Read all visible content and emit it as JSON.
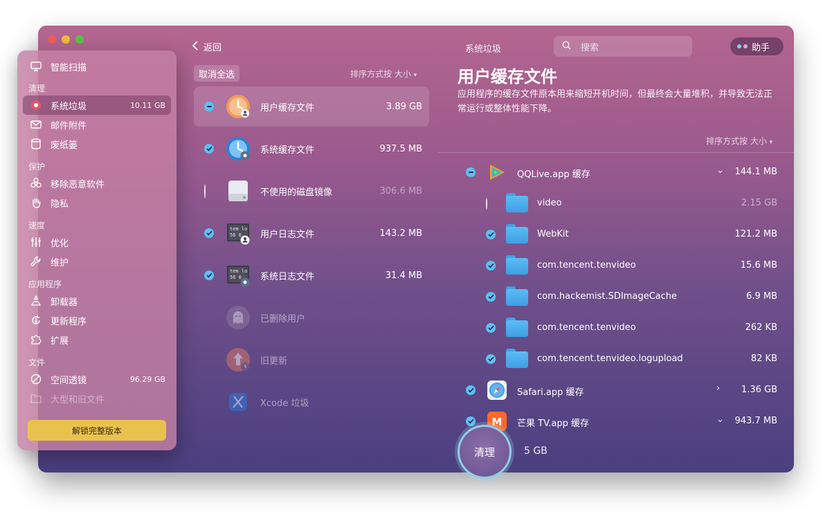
{
  "window": {
    "title": "系统垃圾"
  },
  "sidebar": {
    "smart_scan": "智能扫描",
    "sections": {
      "cleanup": "清理",
      "protect": "保护",
      "speed": "速度",
      "apps": "应用程序",
      "files": "文件"
    },
    "items": {
      "system_junk": {
        "label": "系统垃圾",
        "size": "10.11 GB"
      },
      "mail_attachments": "邮件附件",
      "trash": "废纸篓",
      "malware_removal": "移除恶意软件",
      "privacy": "隐私",
      "optimization": "优化",
      "maintenance": "维护",
      "uninstaller": "卸载器",
      "updater": "更新程序",
      "extensions": "扩展",
      "space_lens": {
        "label": "空间透镜",
        "size": "96.29 GB"
      },
      "large_old_files": "大型和旧文件"
    },
    "unlock_button": "解锁完整版本"
  },
  "middle": {
    "back": "返回",
    "deselect_all": "取消全选",
    "sort": "排序方式按 大小",
    "categories": [
      {
        "label": "用户缓存文件",
        "size": "3.89 GB",
        "state": "partial",
        "icon": "user-cache-clock-icon"
      },
      {
        "label": "系统缓存文件",
        "size": "937.5 MB",
        "state": "checked",
        "icon": "system-cache-clock-icon"
      },
      {
        "label": "不使用的磁盘镜像",
        "size": "306.6 MB",
        "state": "unchecked",
        "icon": "disk-image-icon"
      },
      {
        "label": "用户日志文件",
        "size": "143.2 MB",
        "state": "checked",
        "icon": "user-log-icon"
      },
      {
        "label": "系统日志文件",
        "size": "31.4 MB",
        "state": "checked",
        "icon": "system-log-icon"
      },
      {
        "label": "已删除用户",
        "size": "",
        "state": "none",
        "icon": "ghost-user-icon"
      },
      {
        "label": "旧更新",
        "size": "",
        "state": "none",
        "icon": "old-update-icon"
      },
      {
        "label": "Xcode 垃圾",
        "size": "",
        "state": "none",
        "icon": "xcode-icon"
      }
    ]
  },
  "header": {
    "search_placeholder": "搜索",
    "assistant": "助手"
  },
  "detail": {
    "title": "用户缓存文件",
    "description": "应用程序的缓存文件原本用来缩短开机时间，但最终会大量堆积，并导致无法正常运行或整体性能下降。",
    "sort": "排序方式按 大小",
    "files": [
      {
        "name": "QQLive.app 缓存",
        "size": "144.1 MB",
        "state": "partial",
        "level": 0,
        "icon": "qqlive-app-icon",
        "chevron": "⌄"
      },
      {
        "name": "video",
        "size": "2.15 GB",
        "state": "unchecked",
        "level": 1,
        "icon": "folder-icon"
      },
      {
        "name": "WebKit",
        "size": "121.2 MB",
        "state": "checked",
        "level": 1,
        "icon": "folder-icon"
      },
      {
        "name": "com.tencent.tenvideo",
        "size": "15.6 MB",
        "state": "checked",
        "level": 1,
        "icon": "folder-icon"
      },
      {
        "name": "com.hackemist.SDImageCache",
        "size": "6.9 MB",
        "state": "checked",
        "level": 1,
        "icon": "folder-icon"
      },
      {
        "name": "com.tencent.tenvideo",
        "size": "262 KB",
        "state": "checked",
        "level": 1,
        "icon": "folder-icon"
      },
      {
        "name": "com.tencent.tenvideo.logupload",
        "size": "82 KB",
        "state": "checked",
        "level": 1,
        "icon": "folder-icon"
      },
      {
        "name": "Safari.app 缓存",
        "size": "1.36 GB",
        "state": "checked",
        "level": 0,
        "icon": "safari-app-icon",
        "chevron": "›"
      },
      {
        "name": "芒果 TV.app 缓存",
        "size": "943.7 MB",
        "state": "checked",
        "level": 0,
        "icon": "mangotv-app-icon",
        "chevron": "⌄"
      }
    ]
  },
  "footer": {
    "clean_button": "清理",
    "total_size": "5 GB"
  }
}
